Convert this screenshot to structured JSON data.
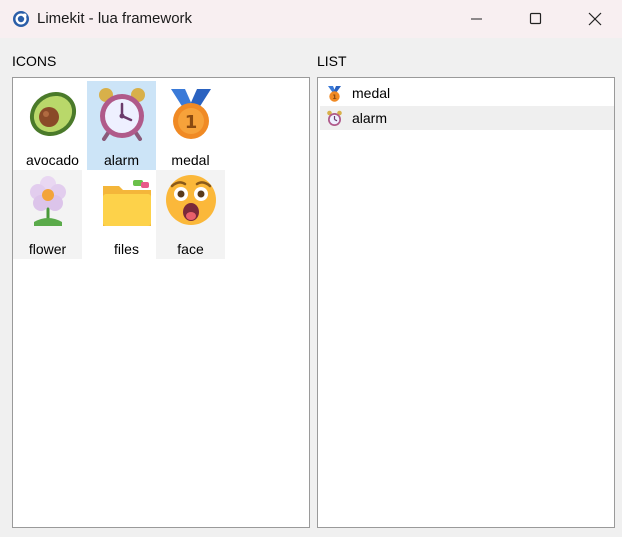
{
  "window": {
    "title": "Limekit - lua framework",
    "app_icon": "limekit-globe-icon",
    "controls": [
      "minimize-icon",
      "maximize-icon",
      "close-icon"
    ]
  },
  "icons_panel": {
    "label": "ICONS",
    "selected": "alarm",
    "items": [
      {
        "label": "avocado",
        "icon": "avocado-icon"
      },
      {
        "label": "alarm",
        "icon": "alarm-clock-icon"
      },
      {
        "label": "medal",
        "icon": "medal-icon"
      },
      {
        "label": "flower",
        "icon": "flower-icon"
      },
      {
        "label": "files",
        "icon": "file-folder-icon"
      },
      {
        "label": "face",
        "icon": "astonished-face-icon"
      }
    ]
  },
  "list_panel": {
    "label": "LIST",
    "items": [
      {
        "label": "medal",
        "icon": "medal-icon"
      },
      {
        "label": "alarm",
        "icon": "alarm-clock-icon"
      }
    ]
  }
}
